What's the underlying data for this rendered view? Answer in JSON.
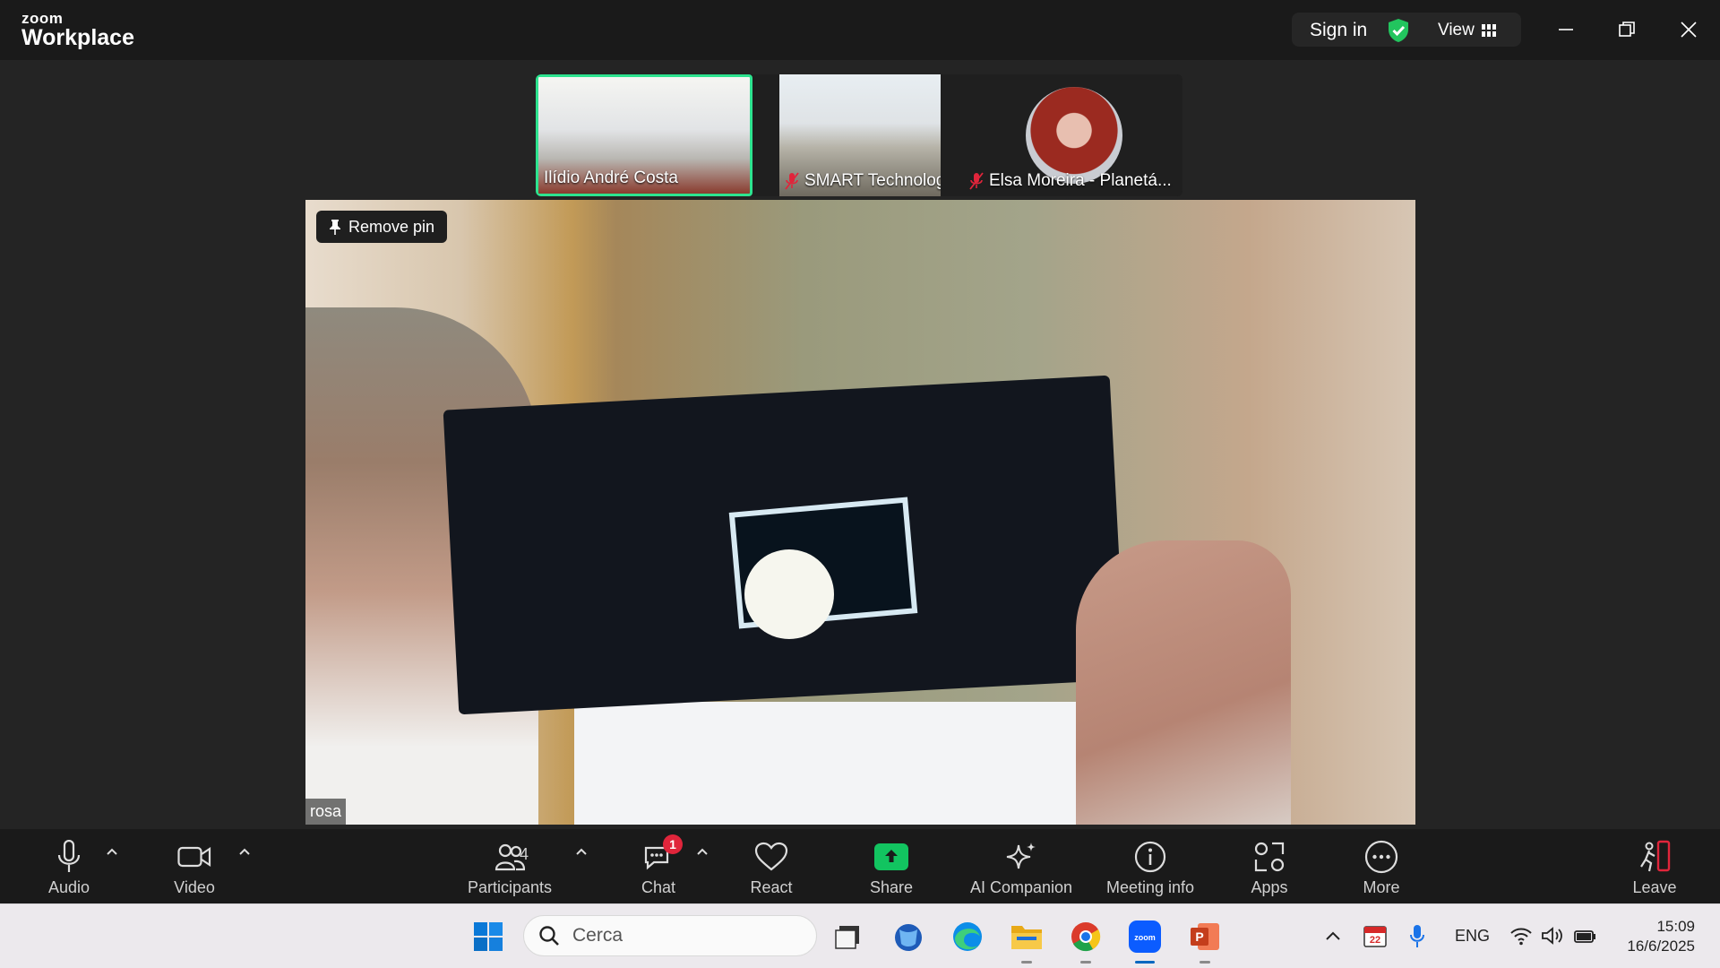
{
  "app": {
    "logo_top": "zoom",
    "logo_bottom": "Workplace"
  },
  "titlebar": {
    "sign_in": "Sign in",
    "view": "View"
  },
  "thumbnails": [
    {
      "name": "Ilídio André Costa",
      "muted": false,
      "active_speaker": true
    },
    {
      "name": "SMART Technologies S...",
      "muted": true
    },
    {
      "name": "Elsa Moreira - Planetá...",
      "muted": true
    }
  ],
  "main_video": {
    "pin_label": "Remove pin",
    "participant_name": "rosa"
  },
  "toolbar": {
    "audio": "Audio",
    "video": "Video",
    "participants": "Participants",
    "participants_count": "4",
    "chat": "Chat",
    "chat_badge": "1",
    "react": "React",
    "share": "Share",
    "ai_companion": "AI Companion",
    "meeting_info": "Meeting info",
    "apps": "Apps",
    "more": "More",
    "leave": "Leave"
  },
  "taskbar": {
    "search_placeholder": "Cerca",
    "calendar_day": "22",
    "language": "ENG",
    "time": "15:09",
    "date": "16/6/2025"
  },
  "colors": {
    "active_speaker": "#2de38f",
    "share": "#12c460",
    "badge": "#e0253b",
    "security": "#22c55e",
    "leave": "#e0253b"
  }
}
